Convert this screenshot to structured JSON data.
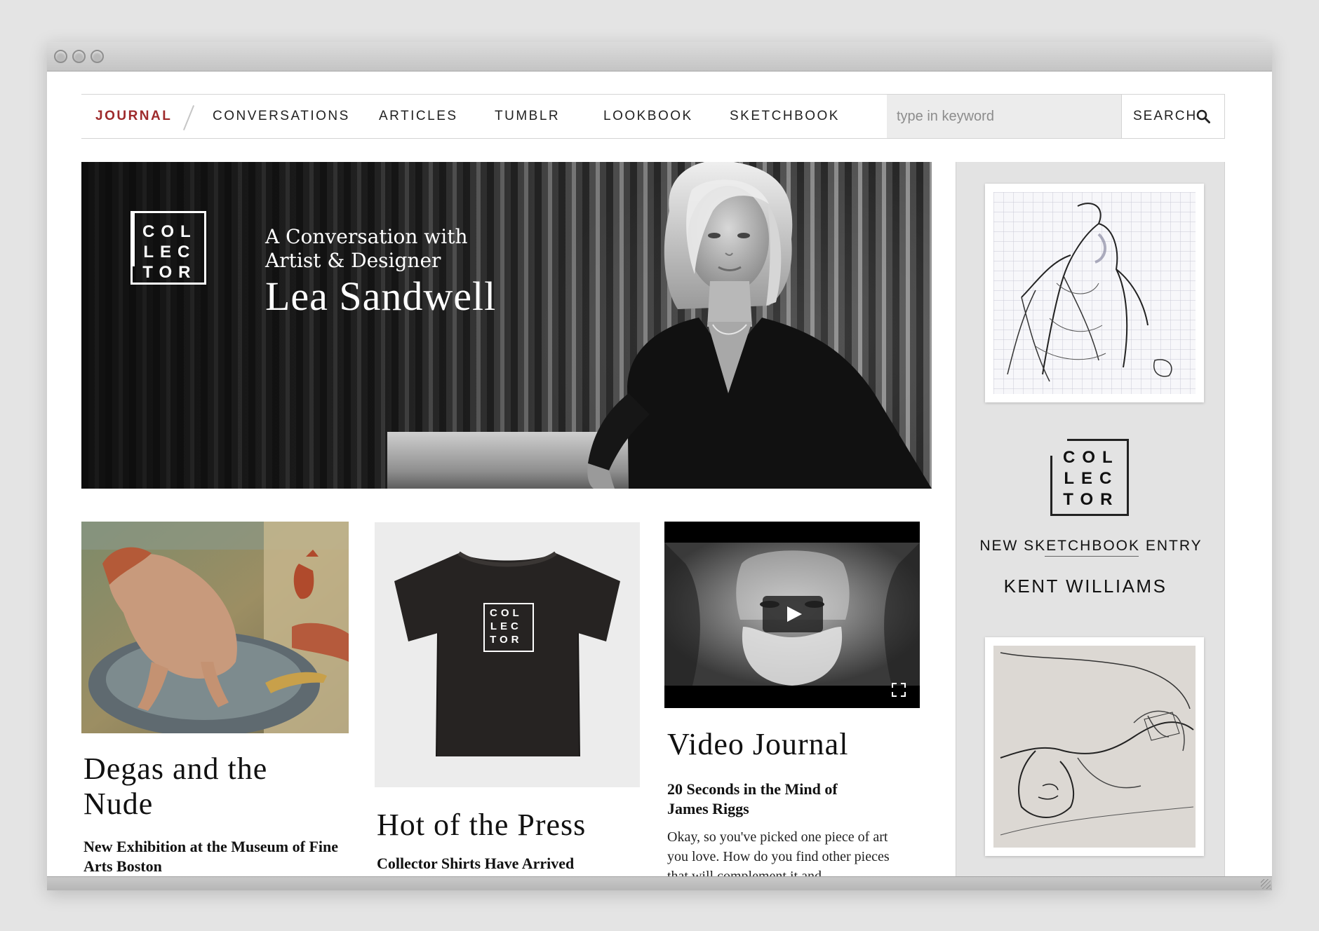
{
  "nav": {
    "items": [
      {
        "label": "JOURNAL",
        "active": true
      },
      {
        "label": "CONVERSATIONS"
      },
      {
        "label": "ARTICLES"
      },
      {
        "label": "TUMBLR"
      },
      {
        "label": "LOOKBOOK"
      },
      {
        "label": "SKETCHBOOK"
      }
    ],
    "search_placeholder": "type in keyword",
    "search_label": "SEARCH"
  },
  "brand": {
    "logo_lines": [
      "COL",
      "LEC",
      "TOR"
    ],
    "accent": "#9e2a2b"
  },
  "hero": {
    "line1": "A Conversation with",
    "line2": "Artist & Designer",
    "name": "Lea Sandwell"
  },
  "cards": [
    {
      "title": "Degas and the Nude",
      "subtitle": "New Exhibition at the Museum of Fine Arts Boston"
    },
    {
      "title": "Hot of the Press",
      "subtitle": "Collector Shirts Have Arrived"
    },
    {
      "title": "Video Journal",
      "subtitle": "20 Seconds in the Mind of James Riggs",
      "body": "Okay, so you've picked one piece of art you love. How do you find other pieces that will complement it and"
    }
  ],
  "sidebar": {
    "entry_label": "NEW SKETCHBOOK ENTRY",
    "artist": "KENT WILLIAMS"
  }
}
